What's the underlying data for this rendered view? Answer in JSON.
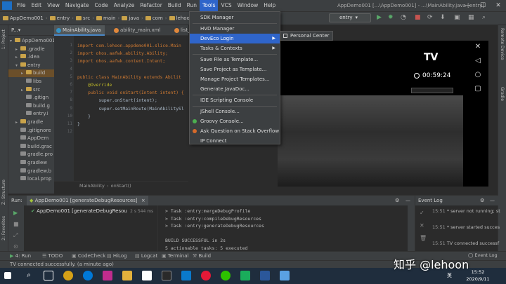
{
  "menubar": {
    "items": [
      "File",
      "Edit",
      "View",
      "Navigate",
      "Code",
      "Analyze",
      "Refactor",
      "Build",
      "Run",
      "Tools",
      "VCS",
      "Window",
      "Help"
    ],
    "active": "Tools"
  },
  "window_title": "AppDemo001 [...\\AppDemo001] - ...\\MainAbility.java [entry]",
  "breadcrumb": [
    "AppDemo001",
    "entry",
    "src",
    "main",
    "java",
    "com",
    "lehoon"
  ],
  "run_config": "entry",
  "project_panel": {
    "title": "P...▾",
    "items": [
      {
        "label": "AppDemo001",
        "indent": 0,
        "arrow": "▾"
      },
      {
        "label": ".gradle",
        "indent": 1,
        "arrow": "▸"
      },
      {
        "label": ".idea",
        "indent": 1,
        "arrow": "▸"
      },
      {
        "label": "entry",
        "indent": 1,
        "arrow": "▾"
      },
      {
        "label": "build",
        "indent": 2,
        "arrow": "▸"
      },
      {
        "label": "libs",
        "indent": 2,
        "arrow": ""
      },
      {
        "label": "src",
        "indent": 2,
        "arrow": "▸"
      },
      {
        "label": ".gitign",
        "indent": 2,
        "arrow": ""
      },
      {
        "label": "build.g",
        "indent": 2,
        "arrow": ""
      },
      {
        "label": "entry.i",
        "indent": 2,
        "arrow": ""
      },
      {
        "label": "gradle",
        "indent": 1,
        "arrow": "▸"
      },
      {
        "label": ".gitignore",
        "indent": 1,
        "arrow": ""
      },
      {
        "label": "AppDem",
        "indent": 1,
        "arrow": ""
      },
      {
        "label": "build.grac",
        "indent": 1,
        "arrow": ""
      },
      {
        "label": "gradle.pro",
        "indent": 1,
        "arrow": ""
      },
      {
        "label": "gradlew",
        "indent": 1,
        "arrow": ""
      },
      {
        "label": "gradlew.b",
        "indent": 1,
        "arrow": ""
      },
      {
        "label": "local.prop",
        "indent": 1,
        "arrow": ""
      }
    ]
  },
  "left_strip": {
    "project": "1: Project",
    "structure": "Z: Structure",
    "favorites": "2: Favorites"
  },
  "right_strip": {
    "preview": "Remote Device",
    "gradle": "Gradle"
  },
  "editor": {
    "tabs": [
      "MainAbility.java",
      "ability_main.xml",
      "list_it"
    ],
    "code_lines": [
      {
        "n": "1",
        "t": "import com.lehoon.appdemo001.slice.Main"
      },
      {
        "n": "2",
        "t": "import ohos.aafwk.ability.Ability;"
      },
      {
        "n": "3",
        "t": "import ohos.aafwk.content.Intent;"
      },
      {
        "n": "4",
        "t": ""
      },
      {
        "n": "5",
        "t": "public class MainAbility extends Abilit"
      },
      {
        "n": "6",
        "t": "    @Override"
      },
      {
        "n": "7",
        "t": "    public void onStart(Intent intent) {"
      },
      {
        "n": "8",
        "t": "        super.onStart(intent);"
      },
      {
        "n": "9",
        "t": "        super.setMainRoute(MainAbilitySl"
      },
      {
        "n": "10",
        "t": "    }"
      },
      {
        "n": "11",
        "t": "}"
      },
      {
        "n": "12",
        "t": ""
      }
    ],
    "breadcrumb": [
      "MainAbility",
      "onStart()"
    ]
  },
  "tools_menu": {
    "items": [
      {
        "label": "SDK Manager",
        "sep_after": true
      },
      {
        "label": "HVD Manager"
      },
      {
        "label": "DevEco Login",
        "submenu": true,
        "highlight": true
      },
      {
        "label": "Tasks & Contexts",
        "submenu": true,
        "sep_after": true
      },
      {
        "label": "Save File as Template..."
      },
      {
        "label": "Save Project as Template..."
      },
      {
        "label": "Manage Project Templates..."
      },
      {
        "label": "Generate JavaDoc...",
        "sep_after": true
      },
      {
        "label": "IDE Scripting Console",
        "sep_after": true
      },
      {
        "label": "JShell Console..."
      },
      {
        "label": "Groovy Console...",
        "icon": "groovy-icon"
      },
      {
        "label": "Ask Question on Stack Overflow",
        "icon": "stackoverflow-icon"
      },
      {
        "label": "IP Connect"
      }
    ],
    "submenu_item": "Personal Center"
  },
  "tv_preview": {
    "title": "TV",
    "time": "00:59:24"
  },
  "run_panel": {
    "header": "Run:",
    "config": "AppDemo001 [generateDebugResources]",
    "task": "AppDemo001 [generateDebugResou",
    "duration": "2 s 544 ms",
    "console": [
      "> Task :entry:mergeDebugProfile",
      "> Task :entry:compileDebugResources",
      "> Task :entry:generateDebugResources",
      "",
      "BUILD SUCCESSFUL in 2s",
      "5 actionable tasks: 5 executed"
    ]
  },
  "event_log": {
    "title": "Event Log",
    "entries": [
      {
        "time": "15:51",
        "msg": "* server not running; st"
      },
      {
        "time": "15:51",
        "msg": "* server started succes"
      },
      {
        "time": "15:51",
        "msg": "TV connected successf"
      }
    ]
  },
  "bottom_tabs": [
    "4: Run",
    "TODO",
    "CodeCheck",
    "HiLog",
    "Logcat",
    "Terminal",
    "Build"
  ],
  "event_log_tab": "Event Log",
  "status_text": "TV connected successfully. (a minute ago)",
  "watermark": "知乎 @lehoon",
  "clock": {
    "time": "15:52",
    "date": "2020/9/11"
  },
  "ime": "英"
}
